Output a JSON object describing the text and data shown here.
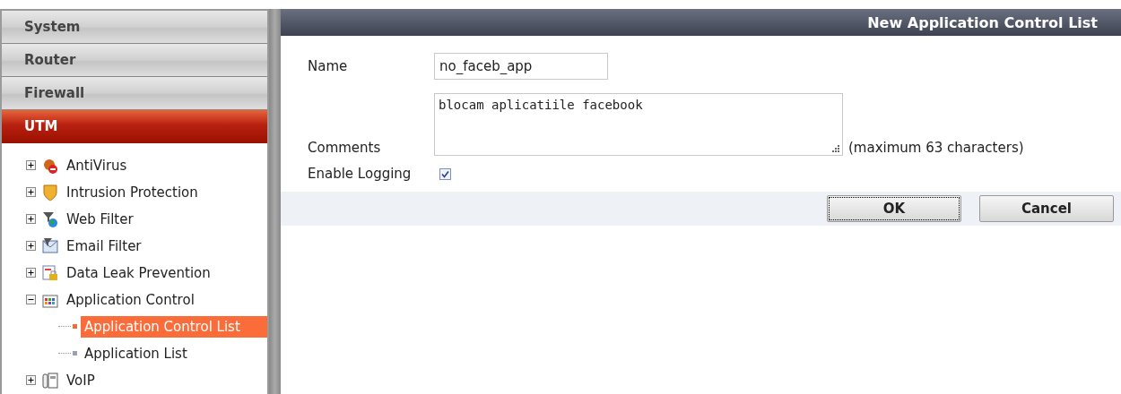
{
  "menu": [
    {
      "label": "System",
      "selected": false
    },
    {
      "label": "Router",
      "selected": false
    },
    {
      "label": "Firewall",
      "selected": false
    },
    {
      "label": "UTM",
      "selected": true
    }
  ],
  "tree": [
    {
      "label": "AntiVirus",
      "expanded": false
    },
    {
      "label": "Intrusion Protection",
      "expanded": false
    },
    {
      "label": "Web Filter",
      "expanded": false
    },
    {
      "label": "Email Filter",
      "expanded": false
    },
    {
      "label": "Data Leak Prevention",
      "expanded": false
    },
    {
      "label": "Application Control",
      "expanded": true,
      "children": [
        {
          "label": "Application Control List",
          "selected": true
        },
        {
          "label": "Application List",
          "selected": false
        }
      ]
    },
    {
      "label": "VoIP",
      "expanded": false
    }
  ],
  "dialog": {
    "title": "New Application Control List",
    "fields": [
      {
        "kind": "text",
        "label": "Name",
        "value": "no_faceb_app"
      },
      {
        "kind": "textarea",
        "label": "Comments",
        "value": "blocam aplicatiile facebook",
        "hint": "(maximum 63 characters)"
      },
      {
        "kind": "checkbox",
        "label": "Enable Logging",
        "checked": true
      }
    ],
    "buttons": [
      {
        "label": "OK",
        "focused": true
      },
      {
        "label": "Cancel",
        "focused": false
      }
    ]
  }
}
